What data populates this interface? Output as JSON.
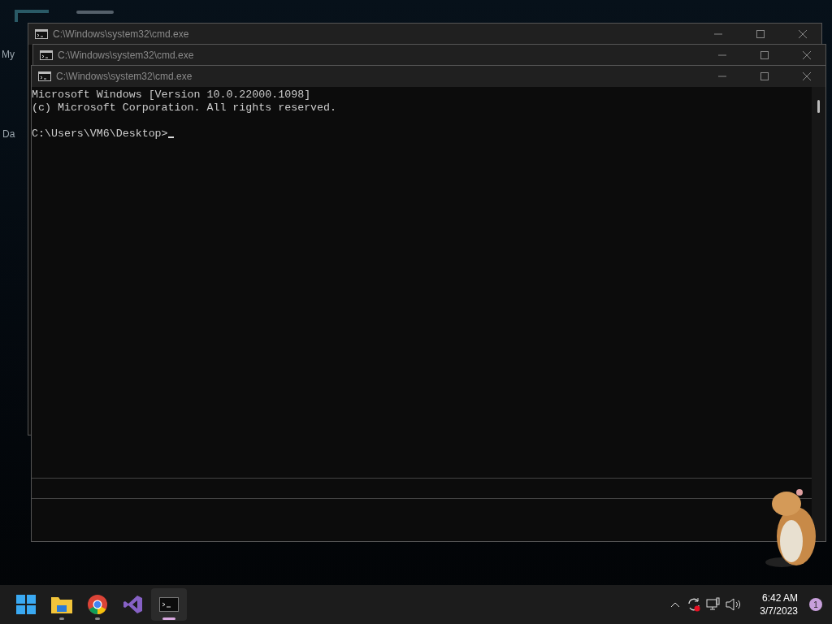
{
  "desktop": {
    "icon_labels": [
      "My",
      "Da"
    ]
  },
  "windows": [
    {
      "title": "C:\\Windows\\system32\\cmd.exe"
    },
    {
      "title": "C:\\Windows\\system32\\cmd.exe"
    },
    {
      "title": "C:\\Windows\\system32\\cmd.exe",
      "console": {
        "lines": [
          "Microsoft Windows [Version 10.0.22000.1098]",
          "(c) Microsoft Corporation. All rights reserved."
        ],
        "prompt": "C:\\Users\\VM6\\Desktop>"
      }
    }
  ],
  "taskbar": {
    "apps": [
      {
        "kind": "start",
        "running": false,
        "selected": false
      },
      {
        "kind": "folder",
        "running": true,
        "selected": false
      },
      {
        "kind": "browser",
        "running": true,
        "selected": false
      },
      {
        "kind": "studio",
        "running": false,
        "selected": false
      },
      {
        "kind": "terminal",
        "running": true,
        "selected": true
      }
    ],
    "time": "6:42 AM",
    "date": "3/7/2023",
    "notifications": "1"
  }
}
